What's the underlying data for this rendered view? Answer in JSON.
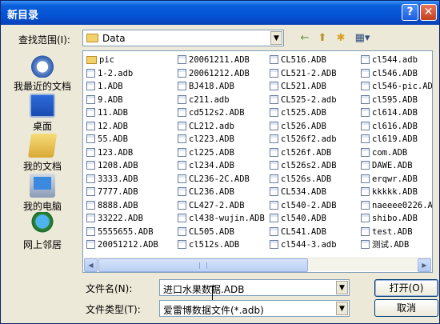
{
  "window": {
    "title": "新目录",
    "help": "?",
    "close": "✕"
  },
  "lookin": {
    "label": "查找范围(I):",
    "value": "Data"
  },
  "places": [
    {
      "label": "我最近的文档",
      "icon": "recent-documents-icon"
    },
    {
      "label": "桌面",
      "icon": "desktop-icon"
    },
    {
      "label": "我的文档",
      "icon": "my-documents-icon"
    },
    {
      "label": "我的电脑",
      "icon": "my-computer-icon"
    },
    {
      "label": "网上邻居",
      "icon": "network-places-icon"
    }
  ],
  "files": {
    "col1": [
      "pic",
      "1-2.adb",
      "1.ADB",
      "9.ADB",
      "11.ADB",
      "12.ADB",
      "55.ADB",
      "123.ADB",
      "1208.ADB",
      "3333.ADB",
      "7777.ADB",
      "8888.ADB",
      "33222.ADB",
      "5555655.ADB",
      "20051212.ADB"
    ],
    "col2": [
      "20061211.ADB",
      "20061212.ADB",
      "BJ418.ADB",
      "c211.adb",
      "cd512s2.ADB",
      "CL212.adb",
      "cl223.ADB",
      "cl225.ADB",
      "cl234.ADB",
      "CL236-2C.ADB",
      "CL236.ADB",
      "CL427-2.ADB",
      "cl438-wujin.ADB",
      "CL505.ADB",
      "cl512s.ADB"
    ],
    "col3": [
      "CL516.ADB",
      "CL521-2.ADB",
      "CL521.ADB",
      "CL525-2.adb",
      "cl525.ADB",
      "cl526.ADB",
      "cl526f2.adb",
      "cl526f.ADB",
      "cl526s2.ADB",
      "cl526s.ADB",
      "CL534.ADB",
      "cl540-2.ADB",
      "cl540.ADB",
      "CL541.ADB",
      "cl544-3.adb"
    ],
    "col4": [
      "cl544.adb",
      "cl546.ADB",
      "cl546-pic.ADB",
      "cl595.ADB",
      "cl614.ADB",
      "cl616.ADB",
      "cl619.ADB",
      "com.ADB",
      "DAWE.ADB",
      "erqwr.ADB",
      "kkkkk.ADB",
      "naeeee0226.ADB",
      "shibo.ADB",
      "test.ADB",
      "测试.ADB"
    ]
  },
  "filename": {
    "label": "文件名(N):",
    "value": "进口水果数据.ADB"
  },
  "filetype": {
    "label": "文件类型(T):",
    "value": "爱雷博数据文件(*.adb)"
  },
  "buttons": {
    "open": "打开(O)",
    "cancel": "取消"
  },
  "toolbar": {
    "back": "←",
    "up": "⬆",
    "newfolder": "✱",
    "views": "▦▾"
  }
}
